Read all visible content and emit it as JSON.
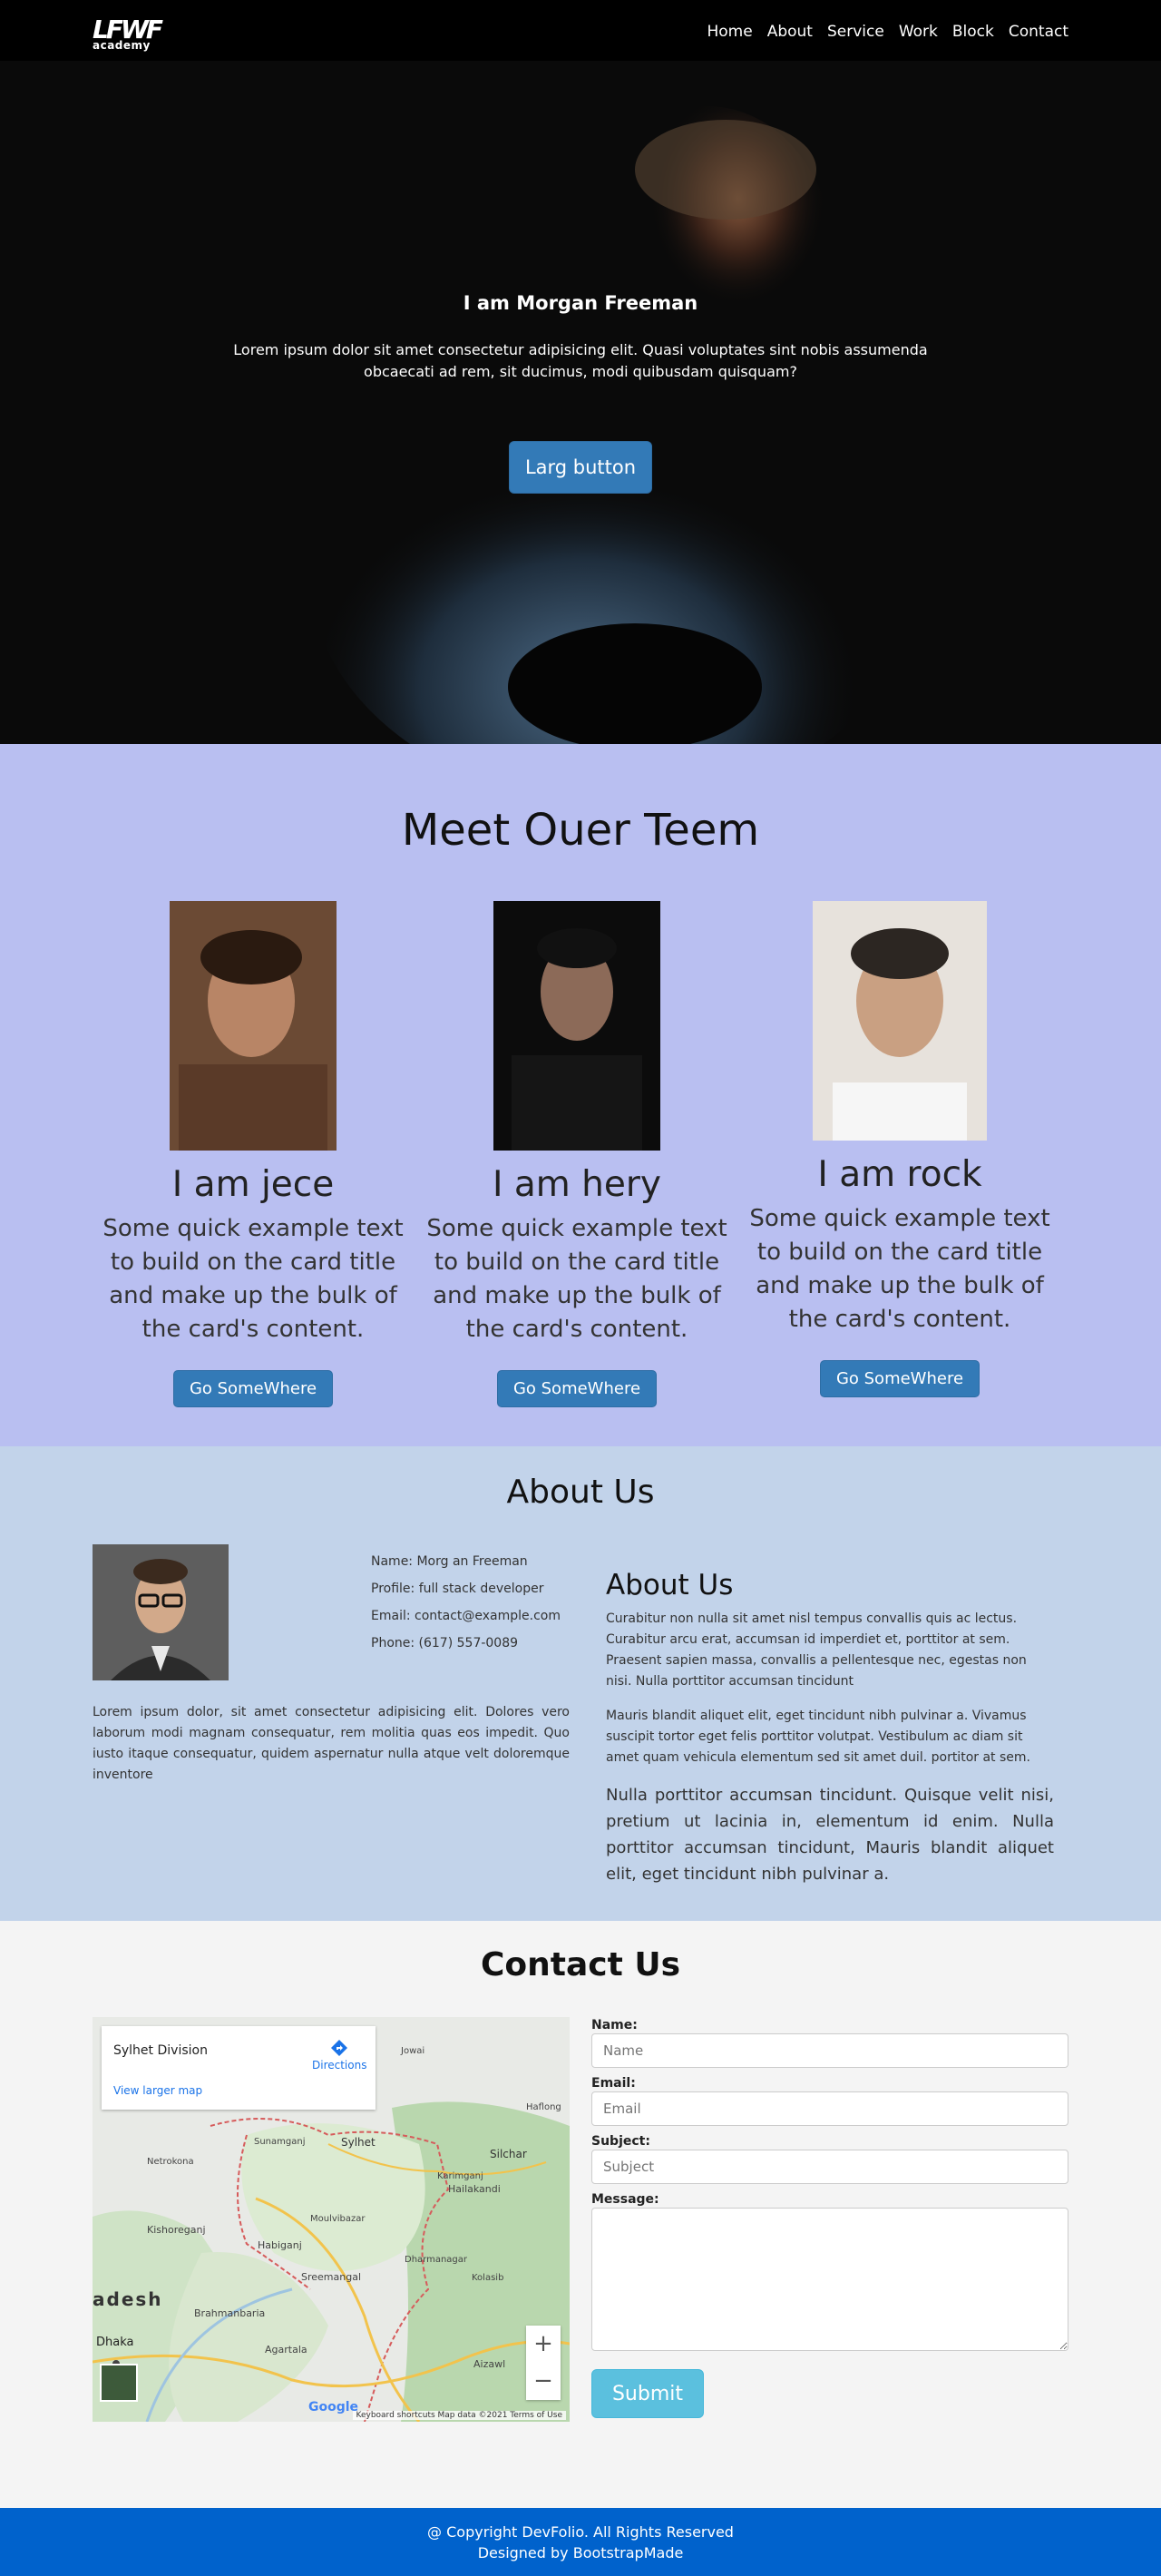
{
  "nav": {
    "logo_mark": "LFWF",
    "logo_text": "academy",
    "links": [
      "Home",
      "About",
      "Service",
      "Work",
      "Block",
      "Contact"
    ]
  },
  "hero": {
    "title": "I am Morgan Freeman",
    "text": "Lorem ipsum dolor sit amet consectetur adipisicing elit. Quasi voluptates sint nobis assumenda obcaecati ad rem, sit ducimus, modi quibusdam quisquam?",
    "button": "Larg button"
  },
  "team": {
    "title": "Meet Ouer Teem",
    "cards": [
      {
        "name": "I am jece",
        "text": "Some quick example text to build on the card title and make up the bulk of the card's content.",
        "button": "Go SomeWhere"
      },
      {
        "name": "I am hery",
        "text": "Some quick example text to build on the card title and make up the bulk of the card's content.",
        "button": "Go SomeWhere"
      },
      {
        "name": "I am rock",
        "text": "Some quick example text to build on the card title and make up the bulk of the card's content.",
        "button": "Go SomeWhere"
      }
    ]
  },
  "about": {
    "title": "About Us",
    "info": {
      "name": "Name: Morg an Freeman",
      "profile": "Profile: full stack developer",
      "email": "Email: contact@example.com",
      "phone": "Phone: (617) 557-0089"
    },
    "left_text": "Lorem ipsum dolor, sit amet consectetur adipisicing elit. Dolores vero laborum modi magnam consequatur, rem molitia quas eos impedit. Quo iusto itaque consequatur, quidem aspernatur nulla atque velt doloremque inventore",
    "right_title": "About Us",
    "p1": "Curabitur non nulla sit amet nisl tempus convallis quis ac lectus. Curabitur arcu erat, accumsan id imperdiet et, porttitor at sem. Praesent sapien massa, convallis a pellentesque nec, egestas non nisi. Nulla porttitor accumsan tincidunt",
    "p2": "Mauris blandit aliquet elit, eget tincidunt nibh pulvinar a. Vivamus suscipit tortor eget felis porttitor volutpat. Vestibulum ac diam sit amet quam vehicula elementum sed sit amet duil. portitor at sem.",
    "p3": "Nulla porttitor accumsan tincidunt. Quisque velit nisi, pretium ut lacinia in, elementum id enim. Nulla porttitor accumsan tincidunt, Mauris blandit aliquet elit, eget tincidunt nibh pulvinar a."
  },
  "contact": {
    "title": "Contact Us",
    "map": {
      "place": "Sylhet Division",
      "directions": "Directions",
      "larger": "View larger map",
      "zoom_in": "+",
      "zoom_out": "−",
      "footer": "Keyboard shortcuts   Map data ©2021   Terms of Use",
      "brand": "Google",
      "labels": [
        "Sylhet",
        "Sunamganj",
        "Habiganj",
        "Moulvibazar",
        "Sreemangal",
        "Kishoreganj",
        "Netrokona",
        "Brahmanbaria",
        "Agartala",
        "Dhaka",
        "adesh",
        "Silchar",
        "Hailakandi",
        "Karimganj",
        "Dharmanagar",
        "Kolasib",
        "Aizawl",
        "Jowai",
        "Haflong"
      ]
    },
    "form": {
      "name_label": "Name:",
      "name_ph": "Name",
      "email_label": "Email:",
      "email_ph": "Email",
      "subject_label": "Subject:",
      "subject_ph": "Subject",
      "message_label": "Message:",
      "submit": "Submit"
    }
  },
  "footer": {
    "line1": "@ Copyright DevFolio. All Rights Reserved",
    "line2": "Designed by BootstrapMade"
  }
}
